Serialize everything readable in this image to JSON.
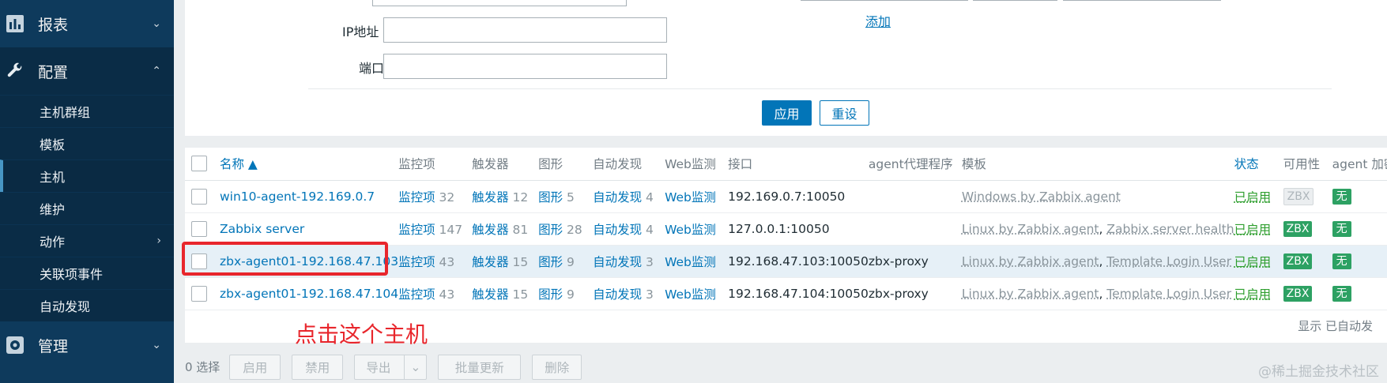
{
  "sidebar": {
    "reports_label": "报表",
    "config_label": "配置",
    "admin_label": "管理",
    "items": [
      {
        "label": "主机群组"
      },
      {
        "label": "模板"
      },
      {
        "label": "主机"
      },
      {
        "label": "维护"
      },
      {
        "label": "动作"
      },
      {
        "label": "关联项事件"
      },
      {
        "label": "自动发现"
      }
    ]
  },
  "filter": {
    "ip_label": "IP地址",
    "port_label": "端口",
    "add_link": "添加",
    "apply": "应用",
    "reset": "重设"
  },
  "table": {
    "headers": {
      "name": "名称 ▲",
      "items": "监控项",
      "triggers": "触发器",
      "graphs": "图形",
      "discovery": "自动发现",
      "web": "Web监测",
      "interface": "接口",
      "proxy": "agent代理程序",
      "templates": "模板",
      "status": "状态",
      "availability": "可用性",
      "encryption": "agent 加密"
    },
    "rows": [
      {
        "name": "win10-agent-192.169.0.7",
        "items": "监控项",
        "items_n": "32",
        "triggers": "触发器",
        "triggers_n": "12",
        "graphs": "图形",
        "graphs_n": "5",
        "disc": "自动发现",
        "disc_n": "4",
        "web": "Web监测",
        "iface": "192.169.0.7:10050",
        "proxy": "",
        "tpl1": "Windows by Zabbix agent",
        "sep": "",
        "tpl2": "",
        "status": "已启用",
        "avail": "ZBX",
        "enc": "无"
      },
      {
        "name": "Zabbix server",
        "items": "监控项",
        "items_n": "147",
        "triggers": "触发器",
        "triggers_n": "81",
        "graphs": "图形",
        "graphs_n": "28",
        "disc": "自动发现",
        "disc_n": "4",
        "web": "Web监测",
        "iface": "127.0.0.1:10050",
        "proxy": "",
        "tpl1": "Linux by Zabbix agent",
        "sep": ", ",
        "tpl2": "Zabbix server health",
        "status": "已启用",
        "avail": "ZBX",
        "enc": "无"
      },
      {
        "name": "zbx-agent01-192.168.47.103",
        "items": "监控项",
        "items_n": "43",
        "triggers": "触发器",
        "triggers_n": "15",
        "graphs": "图形",
        "graphs_n": "9",
        "disc": "自动发现",
        "disc_n": "3",
        "web": "Web监测",
        "iface": "192.168.47.103:10050",
        "proxy": "zbx-proxy",
        "tpl1": "Linux by Zabbix agent",
        "sep": ", ",
        "tpl2": "Template Login User",
        "status": "已启用",
        "avail": "ZBX",
        "enc": "无"
      },
      {
        "name": "zbx-agent01-192.168.47.104",
        "items": "监控项",
        "items_n": "43",
        "triggers": "触发器",
        "triggers_n": "15",
        "graphs": "图形",
        "graphs_n": "9",
        "disc": "自动发现",
        "disc_n": "3",
        "web": "Web监测",
        "iface": "192.168.47.104:10050",
        "proxy": "zbx-proxy",
        "tpl1": "Linux by Zabbix agent",
        "sep": ", ",
        "tpl2": "Template Login User",
        "status": "已启用",
        "avail": "ZBX",
        "enc": "无"
      }
    ],
    "footer_note": "显示 已自动发"
  },
  "annotation": "点击这个主机",
  "bottom": {
    "selected": "0 选择",
    "enable": "启用",
    "disable": "禁用",
    "export": "导出",
    "mass_update": "批量更新",
    "delete": "删除"
  },
  "watermark": "@稀土掘金技术社区",
  "colors": {
    "sidebar": "#0e3a5c",
    "accent": "#0275b8",
    "annotation": "#e8262c",
    "ok": "#2da163"
  }
}
